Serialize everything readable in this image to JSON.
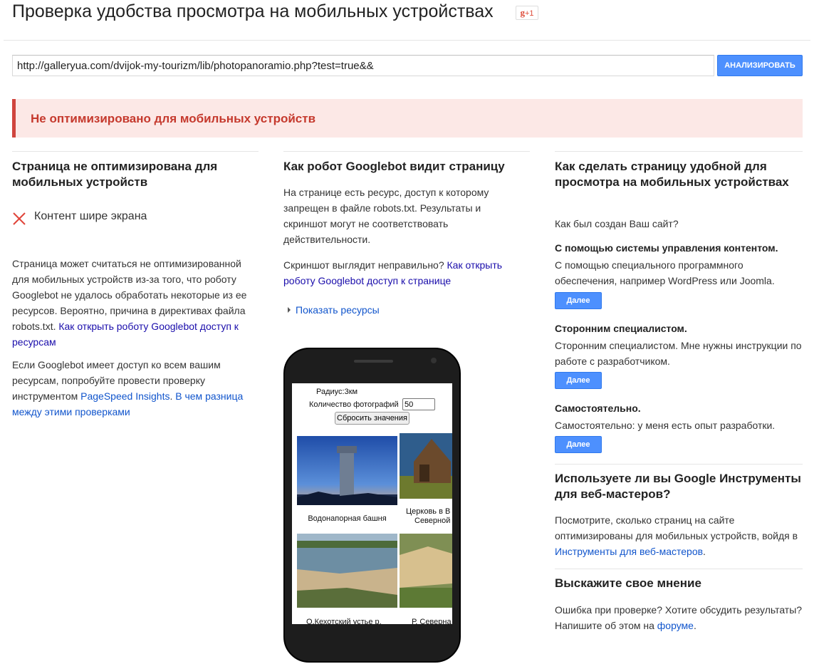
{
  "header": {
    "title": "Проверка удобства просмотра на мобильных устройствах",
    "gplus_g": "g",
    "gplus_plus": "+1"
  },
  "form": {
    "url_value": "http://galleryua.com/dvijok-my-tourizm/lib/photopanoramio.php?test=true&&",
    "analyze_label": "АНАЛИЗИРОВАТЬ"
  },
  "alert": {
    "text": "Не оптимизировано для мобильных устройств",
    "color": "#c5392d"
  },
  "col1": {
    "heading": "Страница не оптимизирована для мобильных устройств",
    "issue": "Контент шире экрана",
    "p1_text": "Страница может считаться не оптимизированной для мобильных устройств из-за того, что роботу Googlebot не удалось обработать некоторые из ее ресурсов. Вероятно, причина в директивах файла robots.txt.",
    "p1_link": "Как открыть роботу Googlebot доступ к ресурсам",
    "p2_text": "Если Googlebot имеет доступ ко всем вашим ресурсам, попробуйте провести проверку инструментом",
    "p2_link1": "PageSpeed Insights",
    "p2_sep": ".",
    "p2_link2": "В чем разница между этими проверками"
  },
  "col2": {
    "heading": "Как робот Googlebot видит страницу",
    "p1": "На странице есть ресурс, доступ к которому запрещен в файле robots.txt. Результаты и скриншот могут не соответствовать действительности.",
    "p2_text": "Скриншот выглядит неправильно?",
    "p2_link": "Как открыть роботу Googlebot доступ к странице",
    "show_resources": "Показать ресурсы",
    "phone": {
      "radius": "Радиус:3км",
      "count_label": "Количество фотографий",
      "count_value": "50",
      "reset_label": "Сбросить значения",
      "captions": [
        "Водонапорная башня",
        "Церковь в В",
        "Северной",
        "О.Кехотский устье р.",
        "Р. Северна"
      ]
    }
  },
  "col3": {
    "heading": "Как сделать страницу удобной для просмотра на мобильных устройствах",
    "question": "Как был создан Ваш сайт?",
    "options": [
      {
        "title": "С помощью системы управления контентом.",
        "desc": "С помощью специального программного обеспечения, например WordPress или Joomla.",
        "button": "Далее"
      },
      {
        "title": "Сторонним специалистом.",
        "desc": "Сторонним специалистом. Мне нужны инструкции по работе с разработчиком.",
        "button": "Далее"
      },
      {
        "title": "Самостоятельно.",
        "desc": "Самостоятельно: у меня есть опыт разработки.",
        "button": "Далее"
      }
    ],
    "wmt_heading": "Используете ли вы Google Инструменты для веб-мастеров?",
    "wmt_text": "Посмотрите, сколько страниц на сайте оптимизированы для мобильных устройств, войдя в",
    "wmt_link": "Инструменты для веб-мастеров",
    "wmt_end": ".",
    "feedback_heading": "Выскажите свое мнение",
    "feedback_text": "Ошибка при проверке? Хотите обсудить результаты? Напишите об этом на",
    "feedback_link": "форуме",
    "feedback_end": "."
  },
  "colors": {
    "accent": "#4d90fe",
    "alert_bg": "#fce8e6",
    "error": "#d0453e",
    "link": "#1155cc"
  }
}
